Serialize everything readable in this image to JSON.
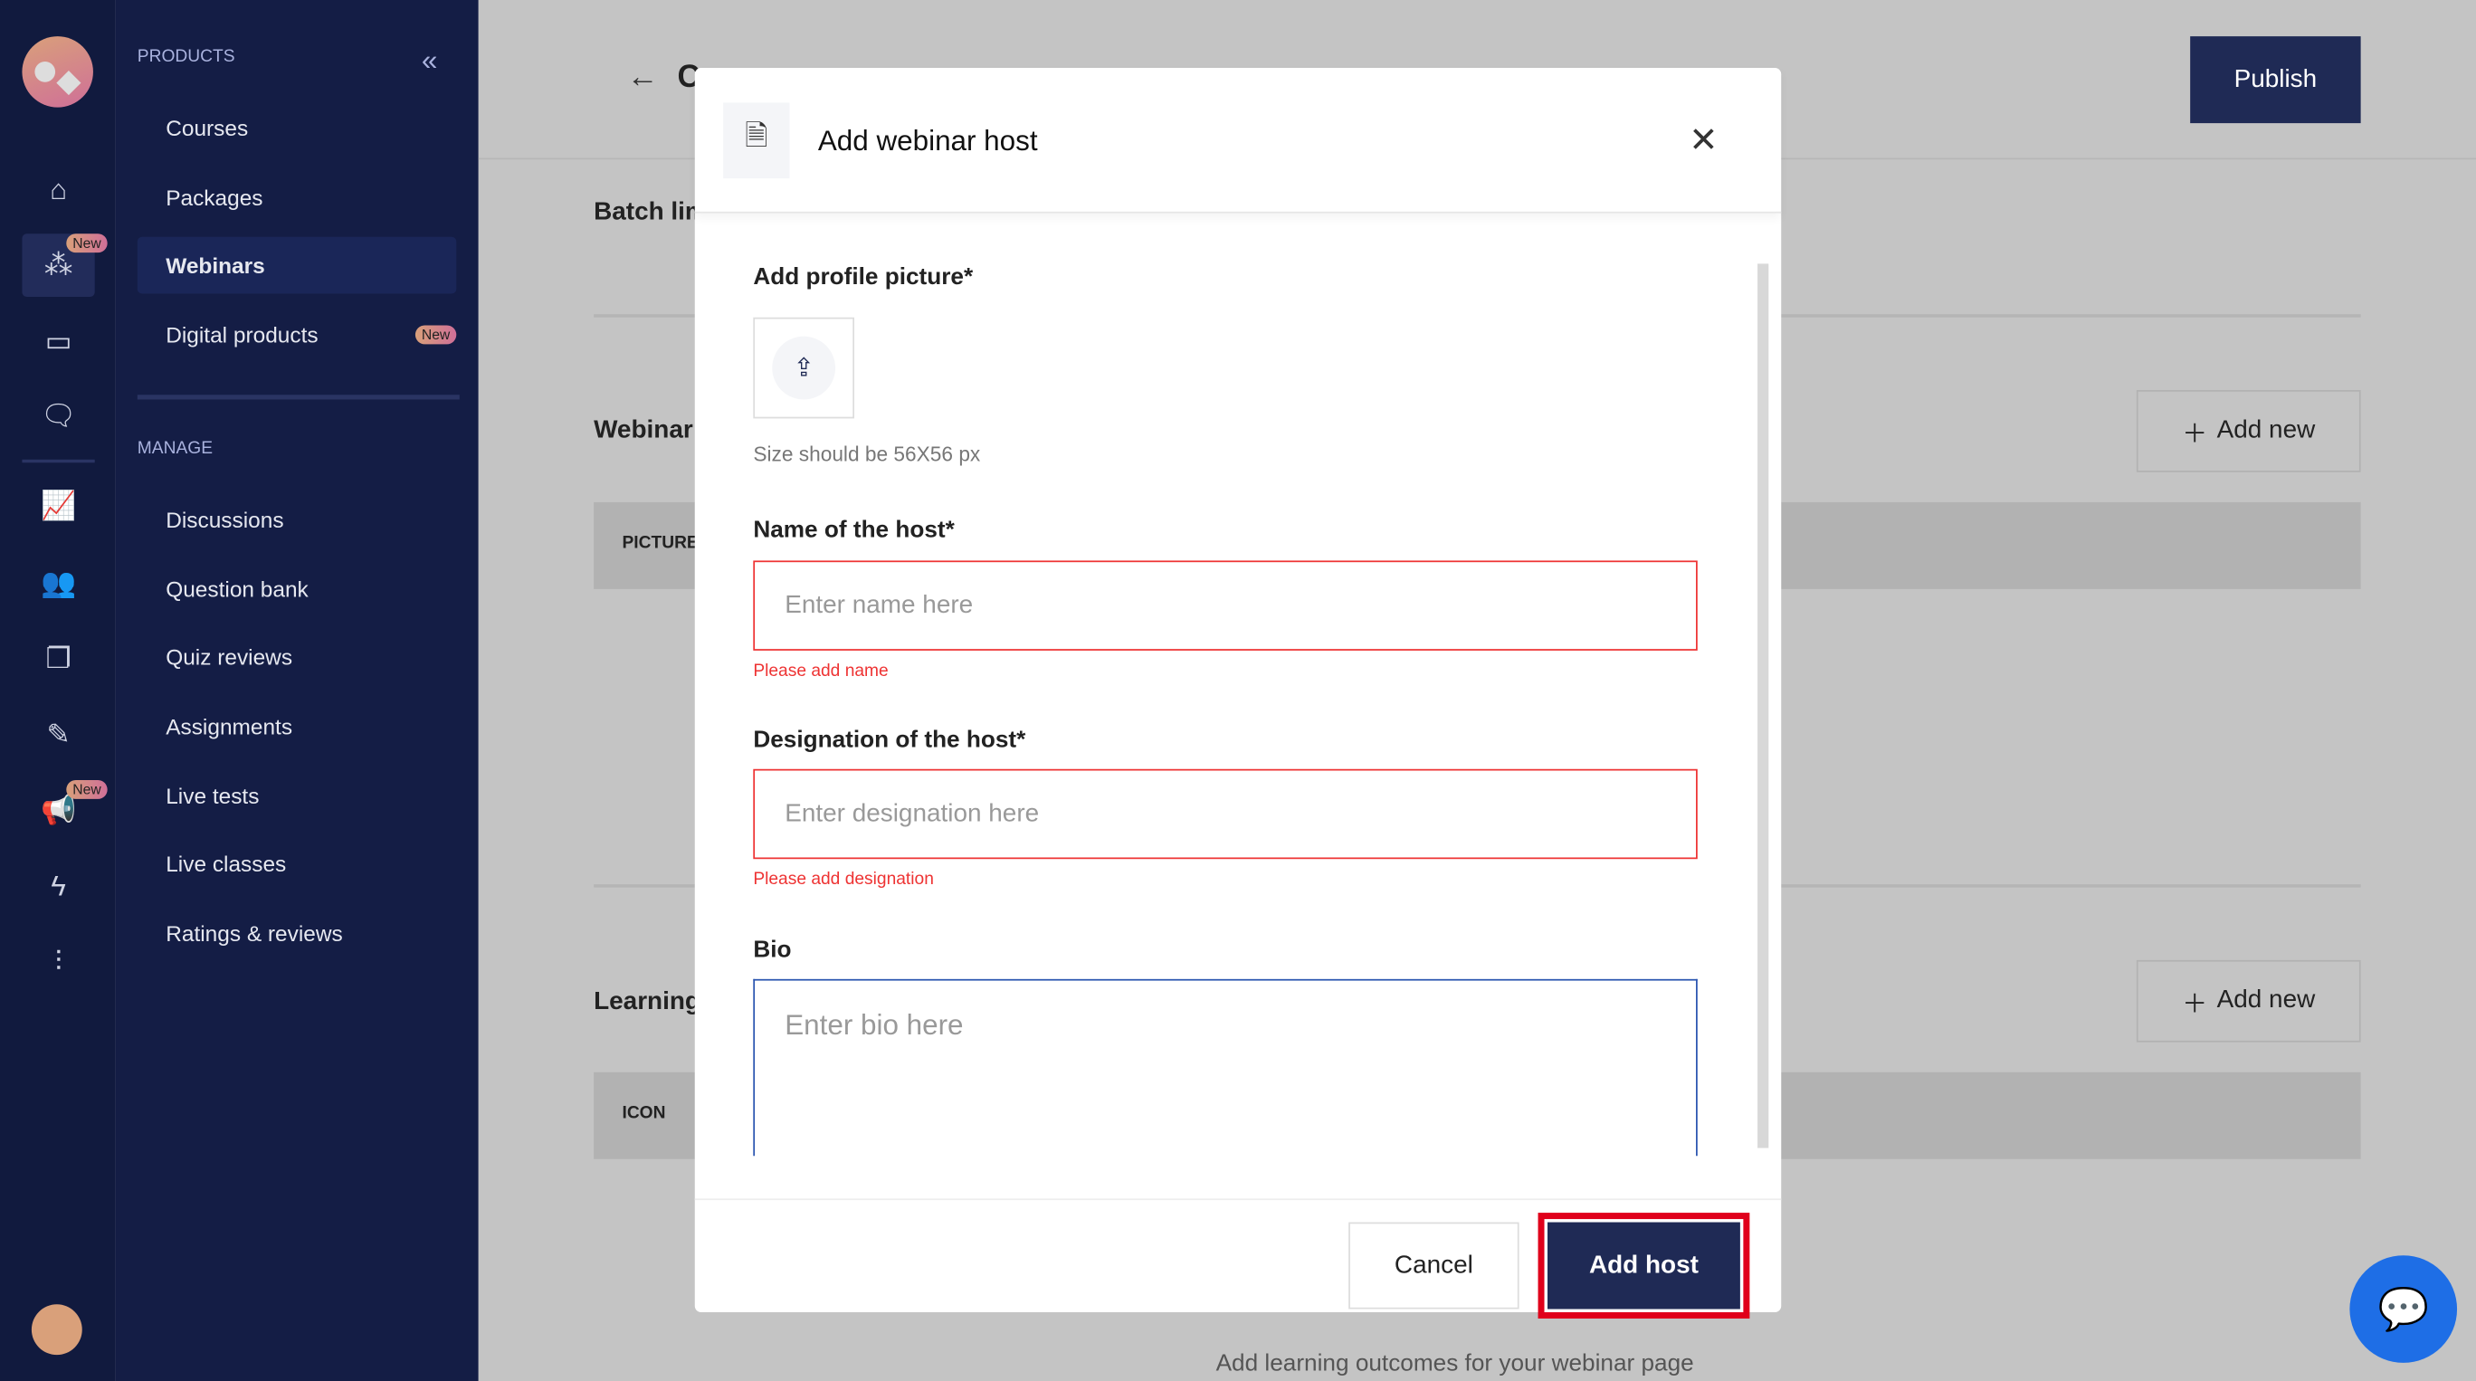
{
  "rail": {
    "icons": [
      "home-icon",
      "webinar-icon",
      "ticket-icon",
      "chat-icon",
      "analytics-icon",
      "users-icon",
      "documents-icon",
      "tools-icon",
      "megaphone-icon",
      "lightning-icon",
      "settings-sliders-icon"
    ],
    "new_badge": "New"
  },
  "sidebar": {
    "products_label": "PRODUCTS",
    "products": [
      {
        "label": "Courses"
      },
      {
        "label": "Packages"
      },
      {
        "label": "Webinars",
        "active": true
      },
      {
        "label": "Digital products",
        "badge": "New"
      }
    ],
    "manage_label": "MANAGE",
    "manage": [
      {
        "label": "Discussions"
      },
      {
        "label": "Question bank"
      },
      {
        "label": "Quiz reviews"
      },
      {
        "label": "Assignments"
      },
      {
        "label": "Live tests"
      },
      {
        "label": "Live classes"
      },
      {
        "label": "Ratings & reviews"
      }
    ]
  },
  "main": {
    "title_partial": "C",
    "publish": "Publish",
    "batch_label": "Batch lim",
    "webinar_label": "Webinar",
    "add_new": "Add new",
    "picture_col": "PICTURE",
    "learning_label": "Learning",
    "icon_col": "ICON",
    "bottom_text": "Add learning outcomes for your webinar page"
  },
  "modal": {
    "title": "Add webinar host",
    "profile_label": "Add profile picture*",
    "size_hint": "Size should be 56X56 px",
    "name_label": "Name of the host*",
    "name_placeholder": "Enter name here",
    "name_error": "Please add name",
    "designation_label": "Designation of the host*",
    "designation_placeholder": "Enter designation here",
    "designation_error": "Please add designation",
    "bio_label": "Bio",
    "bio_placeholder": "Enter bio here",
    "cancel": "Cancel",
    "add_host": "Add host"
  },
  "colors": {
    "accent": "#1f2a55",
    "error": "#e33333",
    "highlight": "#e0001b"
  }
}
